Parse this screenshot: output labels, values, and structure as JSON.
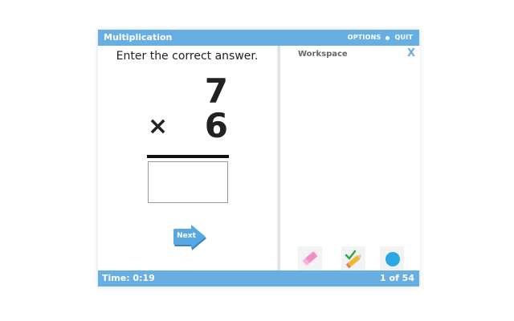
{
  "header": {
    "title": "Multiplication",
    "options_label": "OPTIONS",
    "quit_label": "QUIT"
  },
  "problem": {
    "prompt": "Enter the correct answer.",
    "top_number": "7",
    "operator": "×",
    "bottom_number": "6",
    "answer_value": ""
  },
  "next_button": {
    "label": "Next"
  },
  "workspace": {
    "title": "Workspace",
    "close_label": "X",
    "tools": [
      "eraser-icon",
      "pencil-check-icon",
      "color-dot-icon"
    ]
  },
  "status": {
    "time_label": "Time: 0:19",
    "progress_label": "1 of 54"
  },
  "colors": {
    "accent": "#67aee3",
    "next_button": "#4f9fdb",
    "eraser": "#f28ec8",
    "color_dot": "#2aa8e6"
  }
}
